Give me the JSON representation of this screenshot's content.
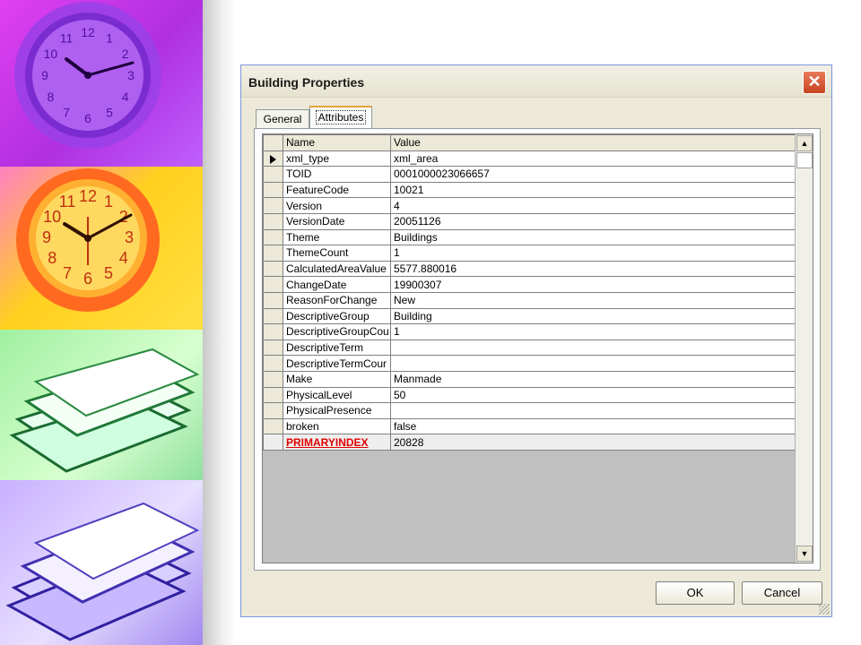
{
  "dialog": {
    "title": "Building Properties",
    "close_glyph": "✕"
  },
  "tabs": [
    {
      "label": "General",
      "selected": false
    },
    {
      "label": "Attributes",
      "selected": true
    }
  ],
  "grid": {
    "columns": [
      "Name",
      "Value"
    ],
    "rows": [
      {
        "name": "xml_type",
        "value": "xml_area",
        "current": true
      },
      {
        "name": "TOID",
        "value": "0001000023066657"
      },
      {
        "name": "FeatureCode",
        "value": "10021"
      },
      {
        "name": "Version",
        "value": "4"
      },
      {
        "name": "VersionDate",
        "value": "20051126"
      },
      {
        "name": "Theme",
        "value": "Buildings"
      },
      {
        "name": "ThemeCount",
        "value": "1"
      },
      {
        "name": "CalculatedAreaValue",
        "value": "5577.880016"
      },
      {
        "name": "ChangeDate",
        "value": "19900307"
      },
      {
        "name": "ReasonForChange",
        "value": "New"
      },
      {
        "name": "DescriptiveGroup",
        "value": "Building"
      },
      {
        "name": "DescriptiveGroupCou",
        "value": "1"
      },
      {
        "name": "DescriptiveTerm",
        "value": ""
      },
      {
        "name": "DescriptiveTermCour",
        "value": ""
      },
      {
        "name": "Make",
        "value": "Manmade"
      },
      {
        "name": "PhysicalLevel",
        "value": "50"
      },
      {
        "name": "PhysicalPresence",
        "value": ""
      },
      {
        "name": "broken",
        "value": "false"
      },
      {
        "name": "PRIMARYINDEX",
        "value": "20828",
        "highlight": true
      }
    ]
  },
  "scrollbar": {
    "up_glyph": "▲",
    "down_glyph": "▼"
  },
  "buttons": {
    "ok": "OK",
    "cancel": "Cancel"
  },
  "decor": {
    "panels": [
      "purple-clock",
      "yellow-clock",
      "green-books",
      "lavender-books"
    ],
    "clock1_numerals": [
      "12",
      "1",
      "2",
      "3",
      "4",
      "5",
      "6",
      "7",
      "8",
      "9",
      "10",
      "11"
    ],
    "clock2_numerals": [
      "12",
      "1",
      "2",
      "3",
      "4",
      "5",
      "6",
      "7",
      "8",
      "9",
      "10",
      "11"
    ]
  }
}
